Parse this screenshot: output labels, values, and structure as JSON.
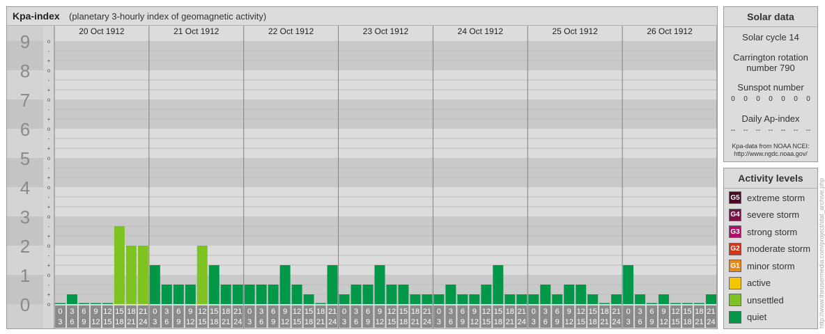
{
  "header": {
    "title": "Kpa-index",
    "subtitle": "(planetary 3-hourly index of geomagnetic activity)"
  },
  "solar": {
    "title": "Solar data",
    "cycle": "Solar cycle 14",
    "carrington_line1": "Carrington rotation",
    "carrington_line2": "number 790",
    "sunspot_label": "Sunspot number",
    "sunspot_values": [
      "0",
      "0",
      "0",
      "0",
      "0",
      "0",
      "0"
    ],
    "ap_label": "Daily Ap-index",
    "ap_values": [
      "--",
      "--",
      "--",
      "--",
      "--",
      "--",
      "--"
    ],
    "source_line1": "Kpa-data from NOAA NCEI:",
    "source_line2": "http://www.ngdc.noaa.gov/"
  },
  "activity": {
    "title": "Activity levels",
    "levels": [
      {
        "code": "G5",
        "label": "extreme storm",
        "color": "#4a0a28"
      },
      {
        "code": "G4",
        "label": "severe storm",
        "color": "#7a1046"
      },
      {
        "code": "G3",
        "label": "strong storm",
        "color": "#b0106a"
      },
      {
        "code": "G2",
        "label": "moderate storm",
        "color": "#d8321e"
      },
      {
        "code": "G1",
        "label": "minor storm",
        "color": "#e88a1a"
      },
      {
        "code": "",
        "label": "active",
        "color": "#f7c400"
      },
      {
        "code": "",
        "label": "unsettled",
        "color": "#7fc323"
      },
      {
        "code": "",
        "label": "quiet",
        "color": "#009848"
      }
    ]
  },
  "watermark": "http://www.theusermedia.com/project/stat_archive.php",
  "chart_data": {
    "type": "bar",
    "title": "Kpa-index",
    "subtitle": "(planetary 3-hourly index of geomagnetic activity)",
    "ylim": [
      0,
      9
    ],
    "y_ticks": [
      "0",
      "1",
      "2",
      "3",
      "4",
      "5",
      "6",
      "7",
      "8",
      "9"
    ],
    "minor_marks": [
      "o",
      "+",
      "-"
    ],
    "days": [
      "20 Oct 1912",
      "21 Oct 1912",
      "22 Oct 1912",
      "23 Oct 1912",
      "24 Oct 1912",
      "25 Oct 1912",
      "26 Oct 1912"
    ],
    "hour_starts": [
      "0",
      "3",
      "6",
      "9",
      "12",
      "15",
      "18",
      "21"
    ],
    "hour_ends": [
      "3",
      "6",
      "9",
      "12",
      "15",
      "18",
      "21",
      "24"
    ],
    "values": [
      [
        0,
        0.333,
        0,
        0,
        0,
        2.667,
        2,
        2
      ],
      [
        1.333,
        0.667,
        0.667,
        0.667,
        2,
        1.333,
        0.667,
        0.667
      ],
      [
        0.667,
        0.667,
        0.667,
        1.333,
        0.667,
        0.333,
        0,
        1.333
      ],
      [
        0.333,
        0.667,
        0.667,
        1.333,
        0.667,
        0.667,
        0.333,
        0.333
      ],
      [
        0.333,
        0.667,
        0.333,
        0.333,
        0.667,
        1.333,
        0.333,
        0.333
      ],
      [
        0.333,
        0.667,
        0.333,
        0.667,
        0.667,
        0.333,
        0,
        0.333
      ],
      [
        1.333,
        0.333,
        0,
        0.333,
        0,
        0,
        0,
        0.333
      ]
    ],
    "colors": {
      "quiet": "#009848",
      "unsettled": "#7fc323",
      "active": "#f7c400"
    }
  }
}
